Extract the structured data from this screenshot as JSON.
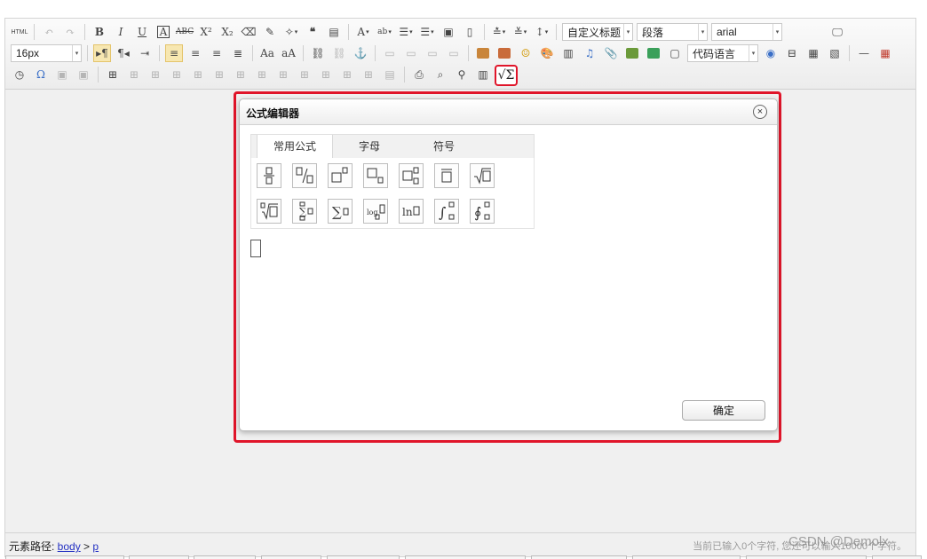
{
  "toolbar": {
    "html_label": "HTML",
    "font_family_combo": "arial",
    "font_size_combo": "16px",
    "heading_combo": "自定义标题",
    "paragraph_combo": "段落",
    "code_language_combo": "代码语言",
    "formula_button_symbol": "√Σ"
  },
  "dialog": {
    "title": "公式编辑器",
    "close_symbol": "×",
    "tabs": [
      "常用公式",
      "字母",
      "符号"
    ],
    "active_tab": "常用公式",
    "confirm_label": "确定",
    "formulas_row1": [
      "fraction",
      "inline-fraction",
      "superscript",
      "subscript",
      "sub-superscript",
      "overline",
      "square-root"
    ],
    "formulas_row2": [
      "nth-root",
      "sum-limits",
      "sum",
      "log",
      "ln",
      "integral",
      "contour-integral"
    ],
    "labels": {
      "sum": "∑",
      "log": "log",
      "ln": "ln"
    }
  },
  "status": {
    "path_label": "元素路径: ",
    "path_body": "body",
    "path_sep": " > ",
    "path_p": "p",
    "wordcount": "当前已输入0个字符, 您还可以输入10000个字符。"
  },
  "watermark": "CSDN @Demolx",
  "colors": {
    "highlight": "#e0152a",
    "active_button": "#f7e7b1"
  }
}
